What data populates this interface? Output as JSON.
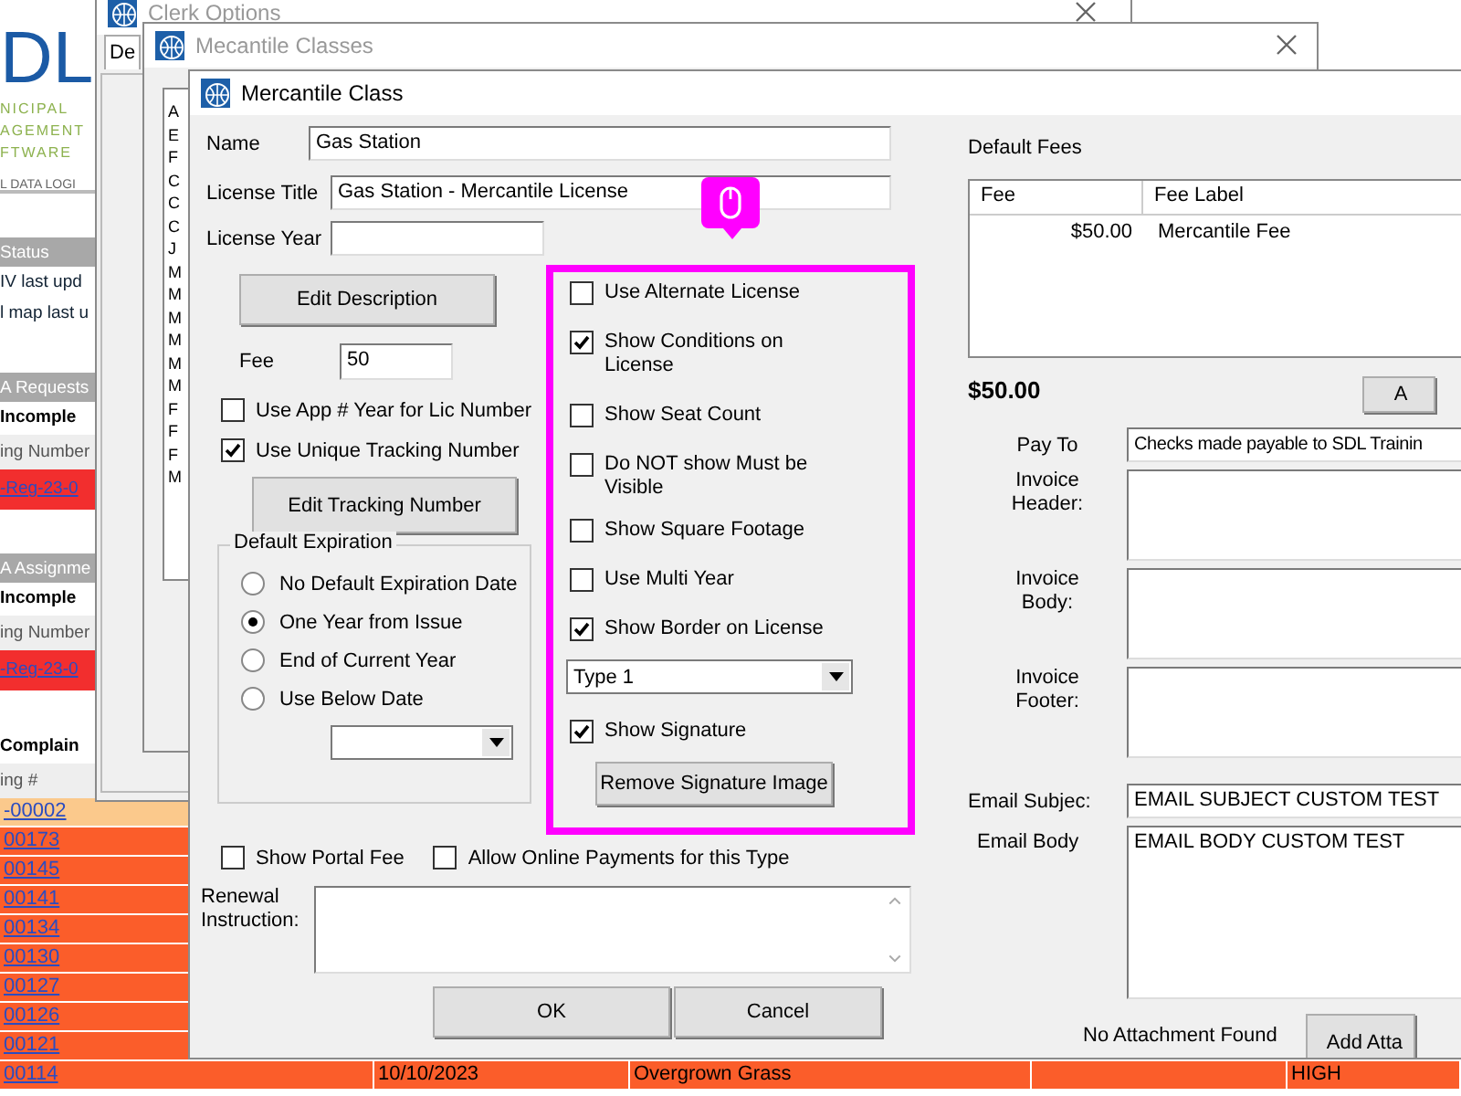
{
  "background_page": {
    "logo": {
      "letters": "DL",
      "lines": [
        "NICIPAL",
        "AGEMENT",
        "FTWARE"
      ],
      "tagline": "L DATA LOGI"
    },
    "status": {
      "header": "Status",
      "lines": [
        "IV last upd",
        "l map last u"
      ]
    },
    "panels": [
      {
        "header": "A Requests",
        "subtitle": "Incomple",
        "column": "ing Number",
        "rows": [
          "-Reg-23-0"
        ]
      },
      {
        "header": "A Assignme",
        "subtitle": "Incomple",
        "column": "ing Number",
        "rows": [
          "-Reg-23-0"
        ]
      }
    ],
    "complaints": {
      "title": "Complain",
      "column": "ing #",
      "rows": [
        {
          "tracking": "-00002",
          "highlighted": true
        },
        {
          "tracking": "00173",
          "highlighted": false
        },
        {
          "tracking": "00145",
          "highlighted": false
        },
        {
          "tracking": "00141",
          "highlighted": false
        },
        {
          "tracking": "00134",
          "highlighted": false
        },
        {
          "tracking": "00130",
          "highlighted": false
        },
        {
          "tracking": "00127",
          "highlighted": false
        },
        {
          "tracking": "00126",
          "highlighted": false
        },
        {
          "tracking": "00121",
          "highlighted": false
        },
        {
          "tracking": "00114",
          "date": "10/10/2023",
          "type": "Overgrown Grass",
          "priority": "HIGH",
          "highlighted": false
        }
      ]
    }
  },
  "clerk_options": {
    "title": "Clerk Options",
    "tabs": [
      {
        "label": "De",
        "selected": true
      }
    ]
  },
  "classes_window": {
    "title": "Mecantile Classes",
    "list_items": [
      "A",
      "E",
      "F",
      "C",
      "C",
      "C",
      "J",
      "M",
      "M",
      "M",
      "M",
      "M",
      "M",
      "F",
      "F",
      "F",
      "M"
    ]
  },
  "dialog": {
    "title": "Mercantile Class",
    "name": {
      "label": "Name",
      "value": "Gas Station"
    },
    "license_title": {
      "label": "License Title",
      "value": "Gas Station - Mercantile License"
    },
    "license_year": {
      "label": "License Year"
    },
    "edit_description_button": "Edit Description",
    "fee": {
      "label": "Fee",
      "value": "50"
    },
    "left_checks": [
      {
        "label": "Use App # Year for Lic Number",
        "checked": false
      },
      {
        "label": "Use Unique Tracking Number",
        "checked": true
      }
    ],
    "edit_tracking_button": "Edit Tracking Number",
    "expiration": {
      "legend": "Default Expiration",
      "options": [
        {
          "label": "No Default Expiration Date",
          "selected": false
        },
        {
          "label": "One Year from Issue",
          "selected": true
        },
        {
          "label": "End of Current Year",
          "selected": false
        },
        {
          "label": "Use Below Date",
          "selected": false
        }
      ]
    },
    "options": [
      {
        "kind": "checkbox",
        "label": "Use Alternate License",
        "checked": false
      },
      {
        "kind": "checkbox",
        "label": "Show Conditions on License",
        "checked": true
      },
      {
        "kind": "checkbox",
        "label": "Show Seat Count",
        "checked": false
      },
      {
        "kind": "checkbox",
        "label": "Do NOT show Must be Visible",
        "checked": false
      },
      {
        "kind": "checkbox",
        "label": "Show Square Footage",
        "checked": false
      },
      {
        "kind": "checkbox",
        "label": "Use Multi Year",
        "checked": false
      },
      {
        "kind": "checkbox",
        "label": "Show Border on License",
        "checked": true
      },
      {
        "kind": "dropdown",
        "value": "Type 1"
      },
      {
        "kind": "checkbox",
        "label": "Show Signature",
        "checked": true
      },
      {
        "kind": "button",
        "label": "Remove Signature Image"
      }
    ],
    "bottom_checks": [
      {
        "label": "Show Portal Fee",
        "checked": false
      },
      {
        "label": "Allow Online Payments for this Type",
        "checked": false
      }
    ],
    "renewal": {
      "label": "Renewal Instruction:"
    },
    "buttons": [
      "OK",
      "Cancel"
    ],
    "default_fees": {
      "label": "Default Fees",
      "columns": [
        "Fee",
        "Fee Label"
      ],
      "rows": [
        [
          "$50.00",
          "Mercantile Fee"
        ]
      ],
      "total": "$50.00",
      "button": "A"
    },
    "pay_to": {
      "label": "Pay To",
      "value": "Checks made payable to SDL Trainin"
    },
    "invoice_fields": [
      {
        "label": "Invoice Header:"
      },
      {
        "label": "Invoice Body:"
      },
      {
        "label": "Invoice Footer:"
      }
    ],
    "email_subject": {
      "label": "Email Subjec:",
      "value": "EMAIL SUBJECT CUSTOM TEST"
    },
    "email_body": {
      "label": "Email Body",
      "value": "EMAIL BODY CUSTOM TEST"
    },
    "attachment_status": "No Attachment Found",
    "add_attachment_button": "Add Atta"
  }
}
